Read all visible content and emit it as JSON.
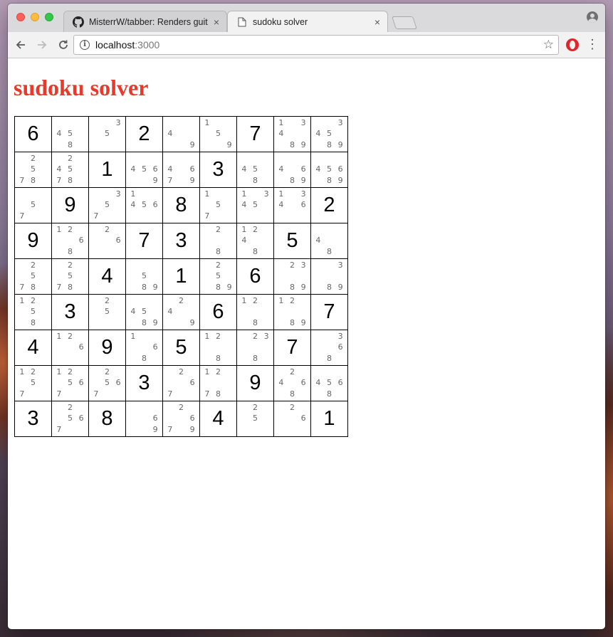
{
  "browser": {
    "tabs": [
      {
        "title": "MisterrW/tabber: Renders guit",
        "icon": "github-icon",
        "active": false
      },
      {
        "title": "sudoku solver",
        "icon": "page-icon",
        "active": true
      }
    ],
    "close_glyph": "×",
    "url_host": "localhost",
    "url_port": ":3000"
  },
  "page": {
    "title": "sudoku solver",
    "title_color": "#e8392b"
  },
  "board": [
    [
      "6",
      [
        "4",
        "5",
        "8"
      ],
      [
        "3",
        "5"
      ],
      "2",
      [
        "4",
        "9"
      ],
      [
        "1",
        "5",
        "9"
      ],
      "7",
      [
        "1",
        "3",
        "4",
        "8",
        "9"
      ],
      [
        "3",
        "4",
        "5",
        "8",
        "9"
      ]
    ],
    [
      [
        "2",
        "5",
        "7",
        "8"
      ],
      [
        "2",
        "4",
        "5",
        "7",
        "8"
      ],
      "1",
      [
        "4",
        "5",
        "6",
        "9"
      ],
      [
        "4",
        "6",
        "7",
        "9"
      ],
      "3",
      [
        "4",
        "5",
        "8"
      ],
      [
        "4",
        "6",
        "8",
        "9"
      ],
      [
        "4",
        "5",
        "6",
        "8",
        "9"
      ]
    ],
    [
      [
        "5",
        "7"
      ],
      "9",
      [
        "3",
        "5",
        "7"
      ],
      [
        "1",
        "4",
        "5",
        "6"
      ],
      "8",
      [
        "1",
        "5",
        "7"
      ],
      [
        "1",
        "3",
        "4",
        "5"
      ],
      [
        "1",
        "3",
        "4",
        "6"
      ],
      "2"
    ],
    [
      "9",
      [
        "1",
        "2",
        "6",
        "8"
      ],
      [
        "2",
        "6"
      ],
      "7",
      "3",
      [
        "2",
        "8"
      ],
      [
        "1",
        "2",
        "4",
        "8"
      ],
      "5",
      [
        "4",
        "8"
      ]
    ],
    [
      [
        "2",
        "5",
        "7",
        "8"
      ],
      [
        "2",
        "5",
        "7",
        "8"
      ],
      "4",
      [
        "5",
        "8",
        "9"
      ],
      "1",
      [
        "2",
        "5",
        "8",
        "9"
      ],
      "6",
      [
        "2",
        "3",
        "8",
        "9"
      ],
      [
        "3",
        "8",
        "9"
      ]
    ],
    [
      [
        "1",
        "2",
        "5",
        "8"
      ],
      "3",
      [
        "2",
        "5"
      ],
      [
        "4",
        "5",
        "8",
        "9"
      ],
      [
        "2",
        "4",
        "9"
      ],
      "6",
      [
        "1",
        "2",
        "8"
      ],
      [
        "1",
        "2",
        "8",
        "9"
      ],
      "7"
    ],
    [
      "4",
      [
        "1",
        "2",
        "6"
      ],
      "9",
      [
        "1",
        "6",
        "8"
      ],
      "5",
      [
        "1",
        "2",
        "8"
      ],
      [
        "2",
        "3",
        "8"
      ],
      "7",
      [
        "3",
        "6",
        "8"
      ]
    ],
    [
      [
        "1",
        "2",
        "5",
        "7"
      ],
      [
        "1",
        "2",
        "5",
        "6",
        "7"
      ],
      [
        "2",
        "5",
        "6",
        "7"
      ],
      "3",
      [
        "2",
        "6",
        "7"
      ],
      [
        "1",
        "2",
        "7",
        "8"
      ],
      "9",
      [
        "2",
        "4",
        "6",
        "8"
      ],
      [
        "4",
        "5",
        "6",
        "8"
      ]
    ],
    [
      "3",
      [
        "2",
        "5",
        "6",
        "7"
      ],
      "8",
      [
        "6",
        "9"
      ],
      [
        "2",
        "6",
        "7",
        "9"
      ],
      "4",
      [
        "2",
        "5"
      ],
      [
        "2",
        "6"
      ],
      "1"
    ]
  ]
}
